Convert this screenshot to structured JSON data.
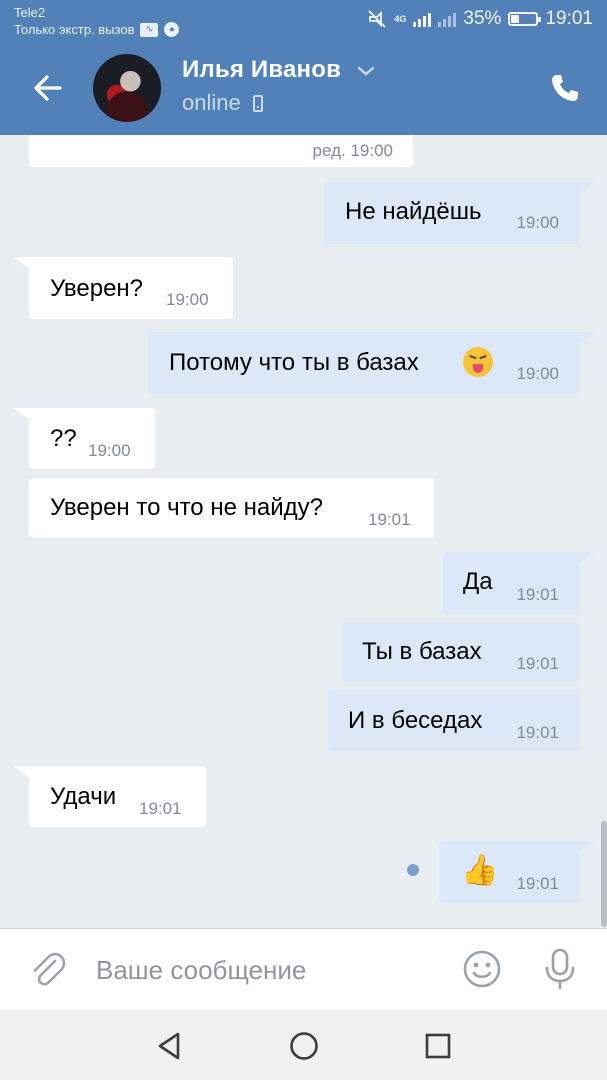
{
  "status_bar": {
    "carrier": "Tele2",
    "carrier_note": "Только экстр. вызов",
    "network": "4G",
    "battery": "35%",
    "battery_level": 0.35,
    "time": "19:01"
  },
  "header": {
    "contact_name": "Илья Иванов",
    "presence": "online",
    "icons": [
      "back-arrow-icon",
      "chevron-down-icon",
      "mobile-phone-icon",
      "phone-call-icon"
    ]
  },
  "messages": [
    {
      "dir": "in",
      "text": "",
      "time": "ред. 19:00"
    },
    {
      "dir": "out",
      "text": "Не найдёшь",
      "time": "19:00"
    },
    {
      "dir": "in",
      "text": "Уверен?",
      "time": "19:00"
    },
    {
      "dir": "out",
      "text": "Потому что ты в базах",
      "emoji": "tongue-out-face-emoji",
      "time": "19:00"
    },
    {
      "dir": "in",
      "text": "??",
      "time": "19:00"
    },
    {
      "dir": "in",
      "text": "Уверен то что не найду?",
      "time": "19:01"
    },
    {
      "dir": "out",
      "text": "Да",
      "time": "19:01"
    },
    {
      "dir": "out",
      "text": "Ты в базах",
      "time": "19:01"
    },
    {
      "dir": "out",
      "text": "И в беседах",
      "time": "19:01"
    },
    {
      "dir": "in",
      "text": "Удачи",
      "time": "19:01"
    },
    {
      "dir": "out",
      "text": "👍",
      "time": "19:01",
      "unread": true
    }
  ],
  "composer": {
    "placeholder": "Ваше сообщение",
    "icons": [
      "paperclip-icon",
      "smile-icon",
      "microphone-icon"
    ]
  },
  "colors": {
    "header": "#5181b8",
    "chat_background": "#e8edf2",
    "incoming_bubble": "#ffffff",
    "outgoing_bubble": "#dce8f7"
  }
}
